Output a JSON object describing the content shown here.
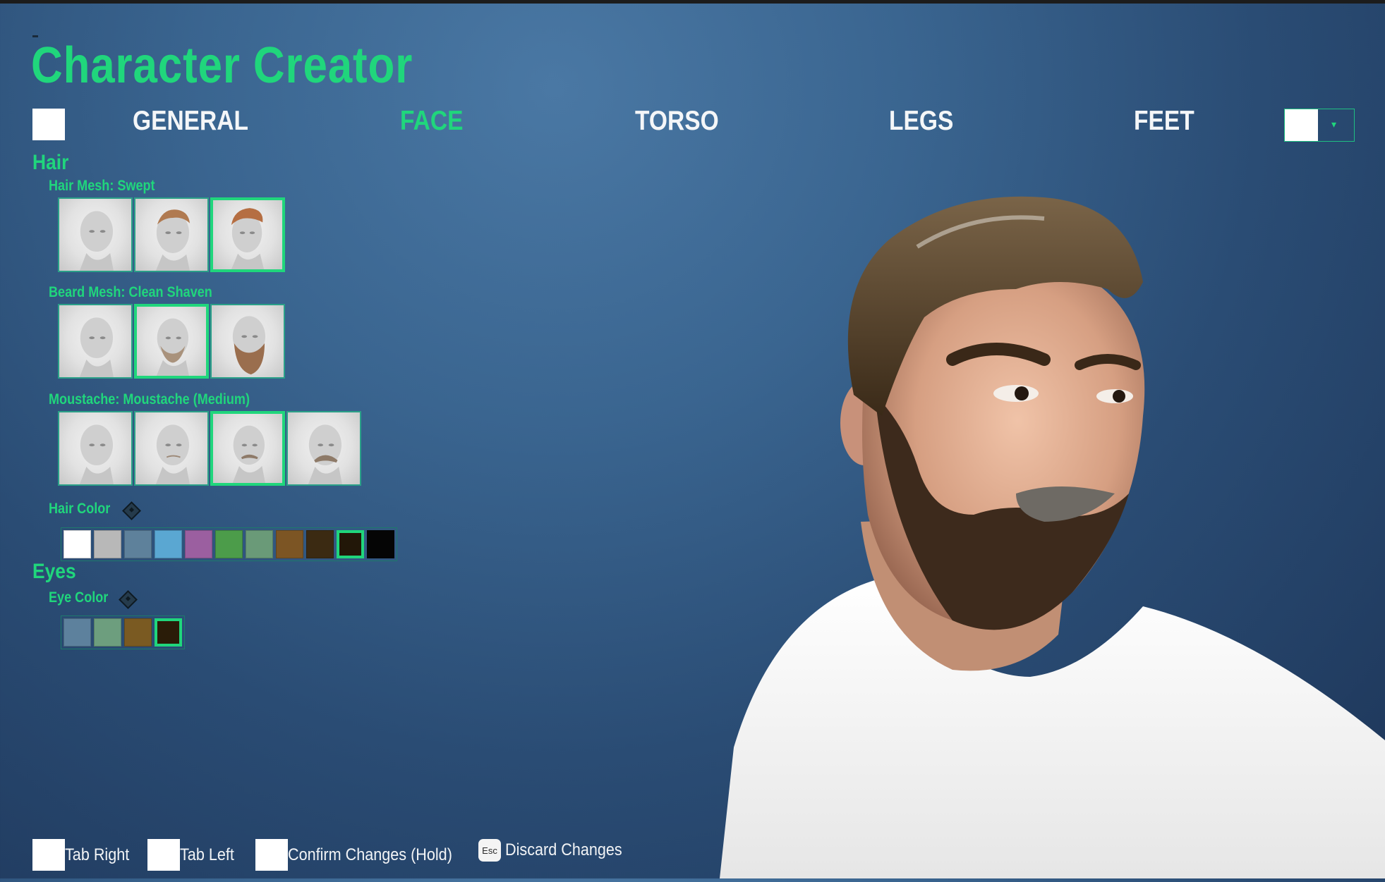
{
  "title": "Character Creator",
  "tabs": [
    "GENERAL",
    "FACE",
    "TORSO",
    "LEGS",
    "FEET"
  ],
  "active_tab": "FACE",
  "hair": {
    "section": "Hair",
    "hair_mesh_label": "Hair Mesh: Swept",
    "hair_mesh_options": [
      "bald",
      "curly",
      "swept"
    ],
    "beard_mesh_label": "Beard Mesh: Clean Shaven",
    "beard_mesh_options": [
      "none",
      "short-beard",
      "long-beard"
    ],
    "moustache_label": "Moustache: Moustache (Medium)",
    "moustache_options": [
      "none",
      "thin",
      "medium",
      "large"
    ],
    "hair_color_label": "Hair Color",
    "hair_colors": [
      "#ffffff",
      "#b8b8b8",
      "#5e819b",
      "#5aa7d2",
      "#9b5fa0",
      "#4c9c4a",
      "#6a9a78",
      "#7c5524",
      "#3b2a12",
      "#221708",
      "#050505"
    ],
    "hair_color_selected": 9
  },
  "eyes": {
    "section": "Eyes",
    "eye_color_label": "Eye Color",
    "eye_colors": [
      "#5d819d",
      "#6d9e7e",
      "#7a5a22",
      "#2a1c08"
    ],
    "eye_color_selected": 3
  },
  "hints": {
    "tab_right": "Tab Right",
    "tab_left": "Tab Left",
    "confirm": "Confirm Changes (Hold)",
    "esc_key": "Esc",
    "discard": "Discard Changes"
  },
  "icons": {
    "key_placeholder": "white-square-icon",
    "reset": "diamond-icon",
    "dropdown": "chevron-down-icon"
  }
}
